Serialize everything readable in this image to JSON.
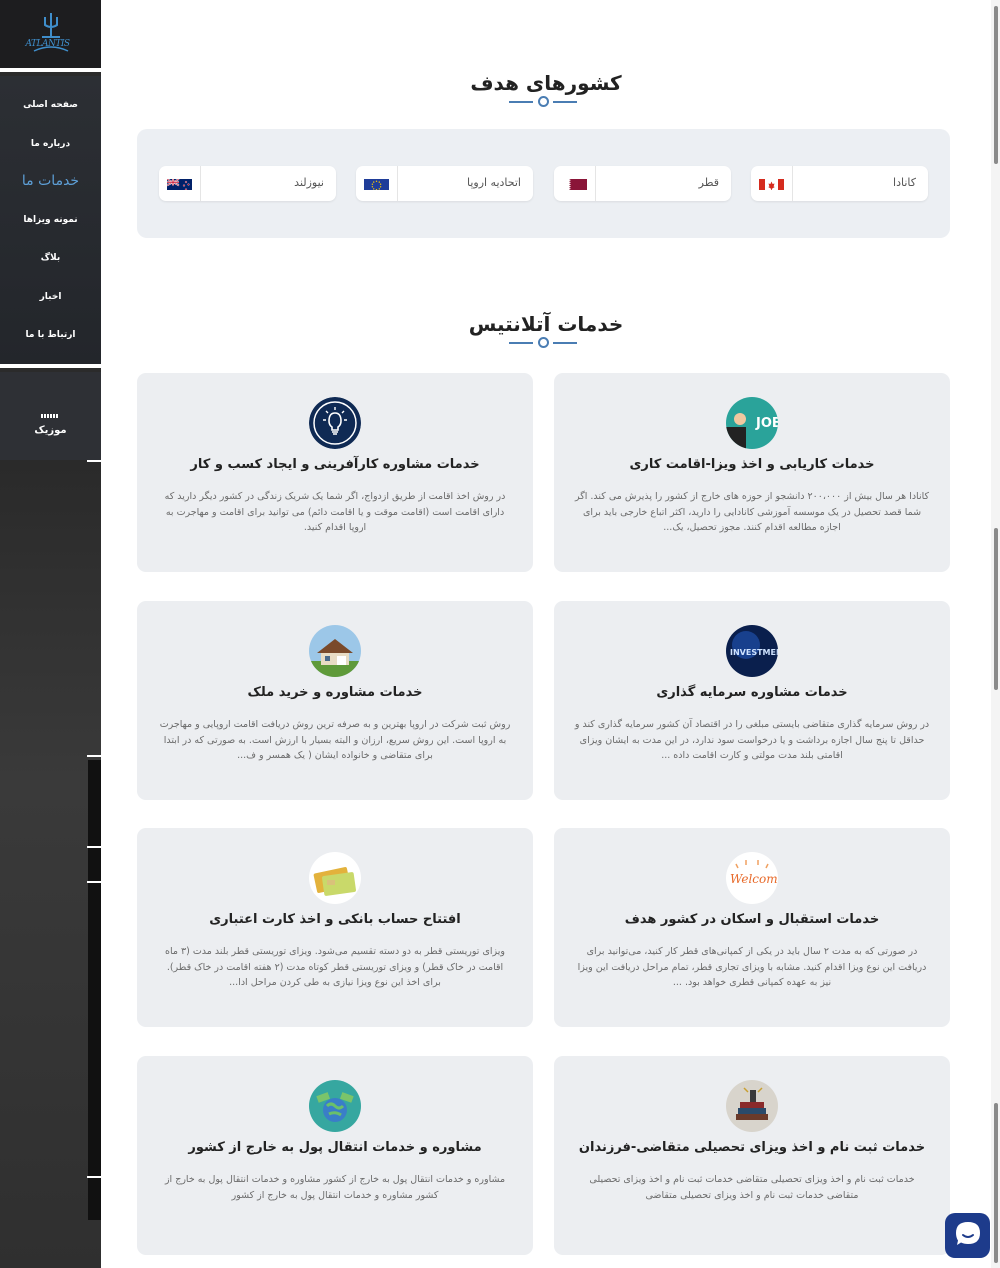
{
  "sidebar": {
    "logo_text": "ATLANTIS",
    "nav": [
      {
        "label": "صفحه اصلی"
      },
      {
        "label": "درباره ما"
      },
      {
        "label": "خدمات ما"
      },
      {
        "label": "نمونه ویزاها"
      },
      {
        "label": "بلاگ"
      },
      {
        "label": "اخبار"
      },
      {
        "label": "ارتباط با ما"
      }
    ],
    "active_index": 2,
    "music_label": "موزیک"
  },
  "countries_section": {
    "title": "کشورهای هدف",
    "countries": [
      {
        "name": "کانادا",
        "flag": "canada-flag"
      },
      {
        "name": "قطر",
        "flag": "qatar-flag"
      },
      {
        "name": "اتحادیه اروپا",
        "flag": "eu-flag"
      },
      {
        "name": "نیوزلند",
        "flag": "new-zealand-flag"
      }
    ]
  },
  "services_section": {
    "title": "خدمات آتلانتیس",
    "cards": [
      {
        "title": "خدمات کاریابی و اخذ ویزا-اقامت کاری",
        "desc": "کانادا هر سال بیش از ۲۰۰،۰۰۰ دانشجو از حوزه های خارج از کشور را پذیرش می کند. اگر شما قصد تحصیل در یک موسسه آموزشی کانادایی را دارید، اکثر اتباع خارجی باید برای اجازه مطالعه اقدام کنند. مجوز تحصیل، یک...",
        "icon": "job-icon"
      },
      {
        "title": "خدمات مشاوره کارآفرینی و ایجاد کسب و کار",
        "desc": "در روش اخذ اقامت از طریق ازدواج، اگر شما یک شریک زندگی در کشور دیگر دارید که دارای اقامت است (اقامت موقت و یا اقامت دائم) می توانید برای اقامت و مهاجرت به اروپا اقدام کنید.",
        "icon": "lightbulb-icon"
      },
      {
        "title": "خدمات مشاوره سرمایه گذاری",
        "desc": "در روش سرمایه گذاری متقاضی بایستی مبلغی را در اقتصاد آن کشور سرمایه گذاری کند و حداقل تا پنج سال اجازه برداشت و یا درخواست سود ندارد، در این مدت به ایشان ویزای اقامتی بلند مدت مولتی و کارت اقامت داده ...",
        "icon": "investment-icon"
      },
      {
        "title": "خدمات مشاوره و خرید ملک",
        "desc": "روش ثبت شرکت در اروپا بهترین و به صرفه ترین روش دریافت اقامت اروپایی و مهاجرت به اروپا است. این روش سریع، ارزان و البته بسیار با ارزش است. به صورتی که در ابتدا برای متقاضی و خانواده ایشان ( یک همسر و ف...",
        "icon": "house-icon"
      },
      {
        "title": "خدمات استقبال و اسکان در کشور هدف",
        "desc": "در صورتی که به مدت ۲ سال باید در یکی از کمپانی‌های قطر کار کنید، می‌توانید برای دریافت این نوع ویزا اقدام کنید. مشابه با ویزای تجاری قطر، تمام مراحل دریافت این ویزا نیز به عهده کمپانی قطری خواهد بود. ...",
        "icon": "welcome-icon"
      },
      {
        "title": "افتتاح حساب بانکی و اخذ کارت اعتباری",
        "desc": "ویزای توریستی قطر به دو دسته تقسیم می‌شود. ویزای توریستی قطر بلند مدت (۳ ماه اقامت در خاک قطر) و ویزای توریستی قطر کوتاه مدت (۲ هفته اقامت در خاک قطر). برای اخذ این نوع ویزا نیازی به طی کردن مراحل ادا...",
        "icon": "credit-card-icon"
      },
      {
        "title": "خدمات ثبت نام و اخذ ویزای تحصیلی متقاضی-فرزندان",
        "desc": "خدمات ثبت نام و اخذ ویزای تحصیلی متقاضی خدمات ثبت نام و اخذ ویزای تحصیلی متقاضی خدمات ثبت نام و اخذ ویزای تحصیلی متقاضی",
        "icon": "books-icon"
      },
      {
        "title": "مشاوره و خدمات انتقال پول به خارج از کشور",
        "desc": "مشاوره و خدمات انتقال پول به خارج از کشور مشاوره و خدمات انتقال پول به خارج از کشور مشاوره و خدمات انتقال پول به خارج از کشور",
        "icon": "money-globe-icon"
      }
    ]
  },
  "colors": {
    "accent": "#4a7db3",
    "sidebar": "#2b2b2b",
    "card_bg": "#eceef1",
    "chat": "#1d3b8b"
  }
}
